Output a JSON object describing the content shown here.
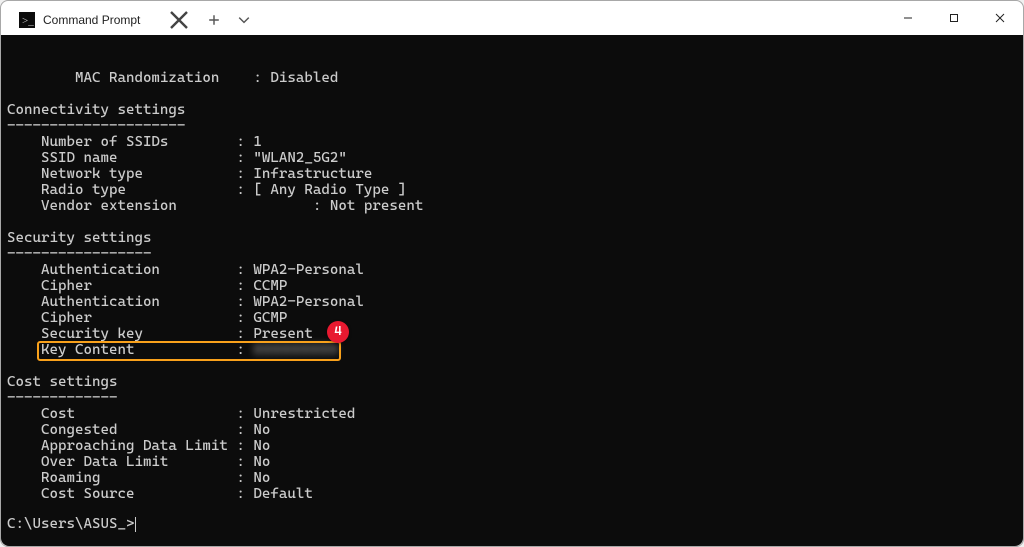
{
  "window": {
    "tab_title": "Command Prompt"
  },
  "badge": "4",
  "prompt": "C:\\Users\\ASUS_>",
  "sections": {
    "top_extra": {
      "key": "MAC Randomization",
      "value": "Disabled"
    },
    "connectivity": {
      "title": "Connectivity settings",
      "dashes": "---------------------",
      "rows": [
        {
          "key": "Number of SSIDs",
          "value": "1"
        },
        {
          "key": "SSID name",
          "value": "\"WLAN2_5G2\""
        },
        {
          "key": "Network type",
          "value": "Infrastructure"
        },
        {
          "key": "Radio type",
          "value": "[ Any Radio Type ]"
        },
        {
          "key": "Vendor extension",
          "value": "Not present",
          "sep_override": "          : "
        }
      ]
    },
    "security": {
      "title": "Security settings",
      "dashes": "-----------------",
      "rows": [
        {
          "key": "Authentication",
          "value": "WPA2-Personal"
        },
        {
          "key": "Cipher",
          "value": "CCMP"
        },
        {
          "key": "Authentication",
          "value": "WPA2-Personal"
        },
        {
          "key": "Cipher",
          "value": "GCMP"
        },
        {
          "key": "Security key",
          "value": "Present"
        },
        {
          "key": "Key Content",
          "value": "XXXXXXXXX",
          "highlight": true,
          "blur": true
        }
      ]
    },
    "cost": {
      "title": "Cost settings",
      "dashes": "-------------",
      "rows": [
        {
          "key": "Cost",
          "value": "Unrestricted"
        },
        {
          "key": "Congested",
          "value": "No"
        },
        {
          "key": "Approaching Data Limit",
          "value": "No"
        },
        {
          "key": "Over Data Limit",
          "value": "No"
        },
        {
          "key": "Roaming",
          "value": "No"
        },
        {
          "key": "Cost Source",
          "value": "Default"
        }
      ]
    }
  },
  "layout": {
    "top_indent": "        ",
    "key_col_width": 22,
    "row_indent": "    ",
    "sep": " : "
  }
}
